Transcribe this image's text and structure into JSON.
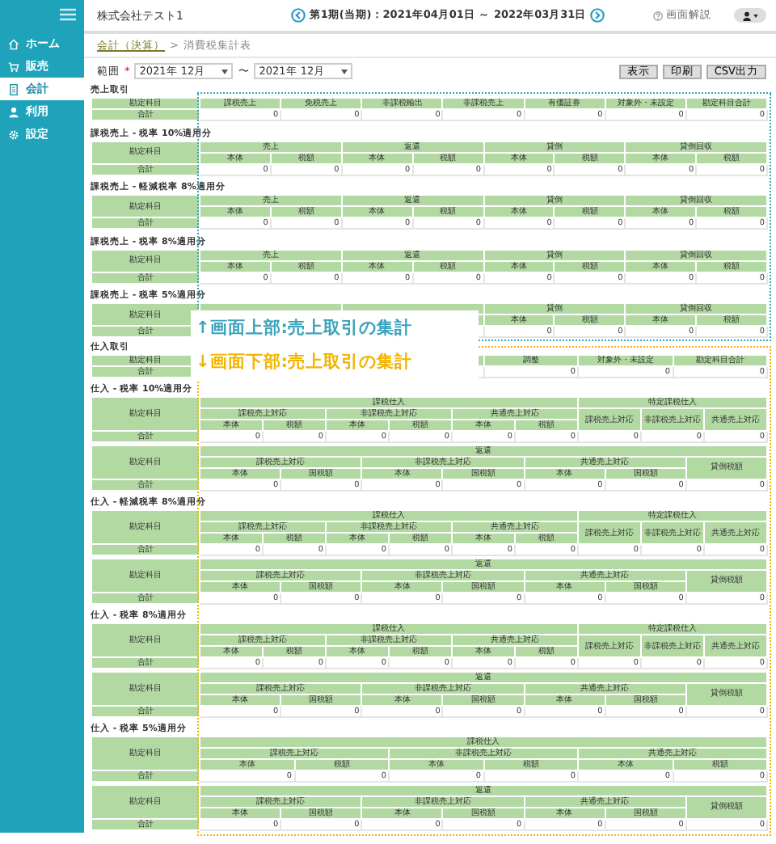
{
  "sidebar": {
    "items": [
      {
        "label": "ホーム",
        "selected": false
      },
      {
        "label": "販売",
        "selected": false
      },
      {
        "label": "会計",
        "selected": true
      },
      {
        "label": "利用",
        "selected": false
      },
      {
        "label": "設定",
        "selected": false
      }
    ]
  },
  "header": {
    "company": "株式会社テスト1",
    "period": "第1期(当期)：2021年04月01日 ～ 2022年03月31日",
    "help": "画面解説"
  },
  "breadcrumb": {
    "link": "会計（決算）",
    "separator": ">",
    "current": "消費税集計表"
  },
  "filter": {
    "label": "範囲",
    "required_mark": "*",
    "from": "2021年 12月",
    "between": "〜",
    "to": "2021年 12月",
    "buttons": [
      "表示",
      "印刷",
      "CSV出力"
    ]
  },
  "groups": [
    {
      "kind": "sales",
      "annotation": "↑画面上部:売上取引の集計",
      "sections": [
        {
          "title": "売上取引",
          "tables": [
            {
              "kind": "summary",
              "label": "勘定科目",
              "headers": [
                [
                  "課税売上",
                  "免税売上",
                  "非課税輸出",
                  "非課税売上",
                  "有価証券",
                  "対象外・未設定",
                  "勘定科目合計"
                ]
              ],
              "total_label": "合計",
              "values": [
                "0",
                "0",
                "0",
                "0",
                "0",
                "0",
                "0"
              ]
            }
          ]
        },
        {
          "title": "課税売上 - 税率 10%適用分",
          "tables": [
            {
              "kind": "sales_tax",
              "label": "勘定科目",
              "headers": [
                [
                  "売上",
                  "返還",
                  "貸倒",
                  "貸倒回収"
                ],
                [
                  "本体",
                  "税額",
                  "本体",
                  "税額",
                  "本体",
                  "税額",
                  "本体",
                  "税額"
                ]
              ],
              "total_label": "合計",
              "values": [
                "0",
                "0",
                "0",
                "0",
                "0",
                "0",
                "0",
                "0"
              ]
            }
          ]
        },
        {
          "title": "課税売上 - 軽減税率 8%適用分",
          "tables": [
            {
              "kind": "sales_tax",
              "label": "勘定科目",
              "headers": [
                [
                  "売上",
                  "返還",
                  "貸倒",
                  "貸倒回収"
                ],
                [
                  "本体",
                  "税額",
                  "本体",
                  "税額",
                  "本体",
                  "税額",
                  "本体",
                  "税額"
                ]
              ],
              "total_label": "合計",
              "values": [
                "0",
                "0",
                "0",
                "0",
                "0",
                "0",
                "0",
                "0"
              ]
            }
          ]
        },
        {
          "title": "課税売上 - 税率 8%適用分",
          "tables": [
            {
              "kind": "sales_tax",
              "label": "勘定科目",
              "headers": [
                [
                  "売上",
                  "返還",
                  "貸倒",
                  "貸倒回収"
                ],
                [
                  "本体",
                  "税額",
                  "本体",
                  "税額",
                  "本体",
                  "税額",
                  "本体",
                  "税額"
                ]
              ],
              "total_label": "合計",
              "values": [
                "0",
                "0",
                "0",
                "0",
                "0",
                "0",
                "0",
                "0"
              ]
            }
          ]
        },
        {
          "title": "課税売上 - 税率 5%適用分",
          "tables": [
            {
              "kind": "sales_tax_covered",
              "label": "勘定科目",
              "headers": [
                [
                  "貸倒",
                  "貸倒回収"
                ],
                [
                  "本体",
                  "税額",
                  "本体",
                  "税額"
                ]
              ],
              "total_label": "合計",
              "values": [
                "0",
                "0",
                "0",
                "0"
              ]
            }
          ]
        }
      ]
    },
    {
      "kind": "purchase",
      "annotation": "↓画面下部:売上取引の集計",
      "sections": [
        {
          "title": "仕入取引",
          "tables": [
            {
              "kind": "summary_covered",
              "label": "勘定科目",
              "headers": [
                [
                  "調整",
                  "対象外・未設定",
                  "勘定科目合計"
                ]
              ],
              "total_label": "合計",
              "values": [
                "0",
                "0",
                "0"
              ]
            }
          ]
        },
        {
          "title": "仕入 - 税率 10%適用分",
          "tables": [
            {
              "kind": "purchase_tax",
              "label": "勘定科目",
              "headers": [
                [
                  "課税仕入",
                  "特定課税仕入"
                ],
                [
                  "課税売上対応",
                  "非課税売上対応",
                  "共通売上対応",
                  "課税売上対応",
                  "非課税売上対応",
                  "共通売上対応"
                ],
                [
                  "本体",
                  "税額",
                  "本体",
                  "税額",
                  "本体",
                  "税額"
                ]
              ],
              "total_label": "合計",
              "values": [
                "0",
                "0",
                "0",
                "0",
                "0",
                "0",
                "0",
                "0",
                "0"
              ]
            },
            {
              "kind": "purchase_return",
              "label": "勘定科目",
              "headers": [
                [
                  "返還"
                ],
                [
                  "課税売上対応",
                  "非課税売上対応",
                  "共通売上対応",
                  "貸倒税額"
                ],
                [
                  "本体",
                  "国税額",
                  "本体",
                  "国税額",
                  "本体",
                  "国税額"
                ]
              ],
              "total_label": "合計",
              "values": [
                "0",
                "0",
                "0",
                "0",
                "0",
                "0",
                "0"
              ]
            }
          ]
        },
        {
          "title": "仕入 - 軽減税率 8%適用分",
          "tables": [
            {
              "kind": "purchase_tax",
              "label": "勘定科目",
              "headers": [
                [
                  "課税仕入",
                  "特定課税仕入"
                ],
                [
                  "課税売上対応",
                  "非課税売上対応",
                  "共通売上対応",
                  "課税売上対応",
                  "非課税売上対応",
                  "共通売上対応"
                ],
                [
                  "本体",
                  "税額",
                  "本体",
                  "税額",
                  "本体",
                  "税額"
                ]
              ],
              "total_label": "合計",
              "values": [
                "0",
                "0",
                "0",
                "0",
                "0",
                "0",
                "0",
                "0",
                "0"
              ]
            },
            {
              "kind": "purchase_return",
              "label": "勘定科目",
              "headers": [
                [
                  "返還"
                ],
                [
                  "課税売上対応",
                  "非課税売上対応",
                  "共通売上対応",
                  "貸倒税額"
                ],
                [
                  "本体",
                  "国税額",
                  "本体",
                  "国税額",
                  "本体",
                  "国税額"
                ]
              ],
              "total_label": "合計",
              "values": [
                "0",
                "0",
                "0",
                "0",
                "0",
                "0",
                "0"
              ]
            }
          ]
        },
        {
          "title": "仕入 - 税率 8%適用分",
          "tables": [
            {
              "kind": "purchase_tax",
              "label": "勘定科目",
              "headers": [
                [
                  "課税仕入",
                  "特定課税仕入"
                ],
                [
                  "課税売上対応",
                  "非課税売上対応",
                  "共通売上対応",
                  "課税売上対応",
                  "非課税売上対応",
                  "共通売上対応"
                ],
                [
                  "本体",
                  "税額",
                  "本体",
                  "税額",
                  "本体",
                  "税額"
                ]
              ],
              "total_label": "合計",
              "values": [
                "0",
                "0",
                "0",
                "0",
                "0",
                "0",
                "0",
                "0",
                "0"
              ]
            },
            {
              "kind": "purchase_return",
              "label": "勘定科目",
              "headers": [
                [
                  "返還"
                ],
                [
                  "課税売上対応",
                  "非課税売上対応",
                  "共通売上対応",
                  "貸倒税額"
                ],
                [
                  "本体",
                  "国税額",
                  "本体",
                  "国税額",
                  "本体",
                  "国税額"
                ]
              ],
              "total_label": "合計",
              "values": [
                "0",
                "0",
                "0",
                "0",
                "0",
                "0",
                "0"
              ]
            }
          ]
        },
        {
          "title": "仕入 - 税率 5%適用分",
          "tables": [
            {
              "kind": "purchase_tax_plain",
              "label": "勘定科目",
              "headers": [
                [
                  "課税仕入"
                ],
                [
                  "課税売上対応",
                  "非課税売上対応",
                  "共通売上対応"
                ],
                [
                  "本体",
                  "税額",
                  "本体",
                  "税額",
                  "本体",
                  "税額"
                ]
              ],
              "total_label": "合計",
              "values": [
                "0",
                "0",
                "0",
                "0",
                "0",
                "0"
              ]
            },
            {
              "kind": "purchase_return",
              "label": "勘定科目",
              "headers": [
                [
                  "返還"
                ],
                [
                  "課税売上対応",
                  "非課税売上対応",
                  "共通売上対応",
                  "貸倒税額"
                ],
                [
                  "本体",
                  "国税額",
                  "本体",
                  "国税額",
                  "本体",
                  "国税額"
                ]
              ],
              "total_label": "合計",
              "values": [
                "0",
                "0",
                "0",
                "0",
                "0",
                "0",
                "0"
              ]
            }
          ]
        }
      ]
    }
  ]
}
